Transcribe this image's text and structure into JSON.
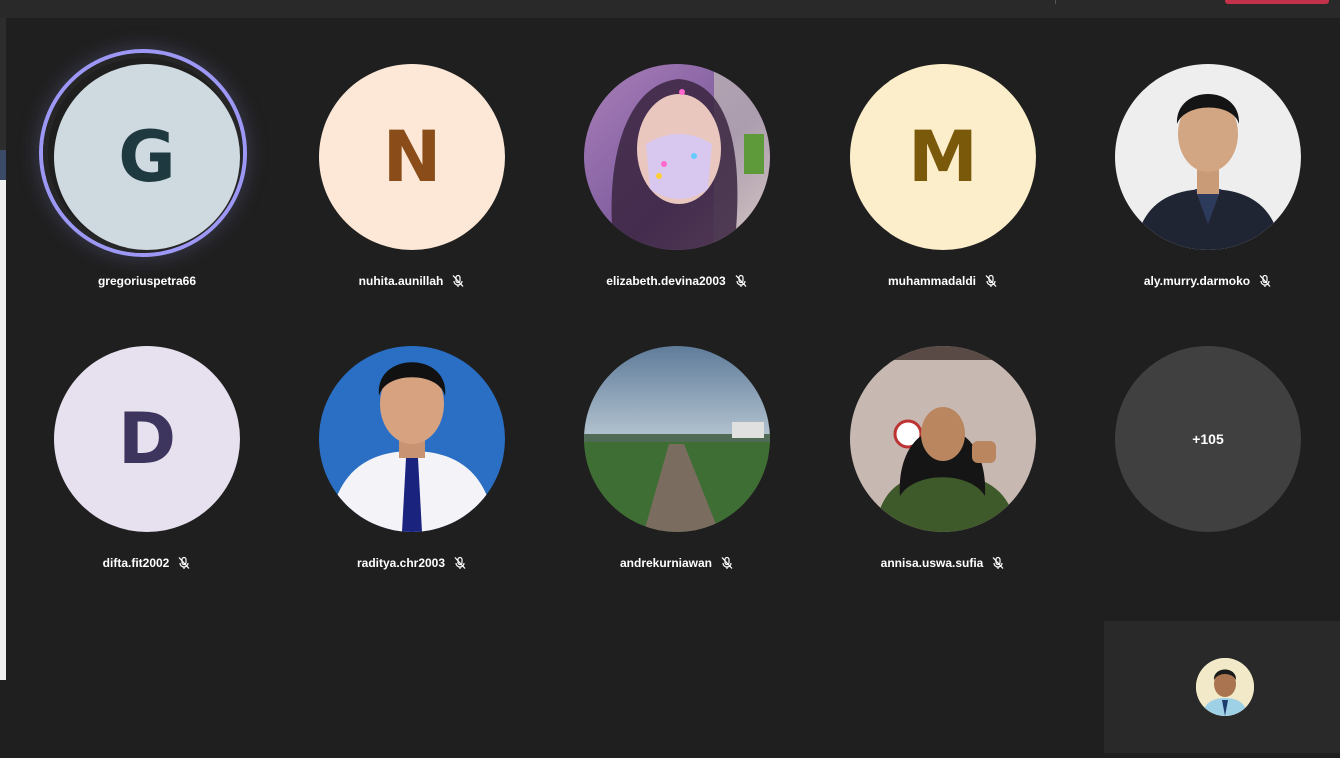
{
  "meeting": {
    "more_participants_label": "+105"
  },
  "participants": [
    {
      "name": "gregoriuspetra66",
      "initial": "G",
      "speaking": true,
      "muted": false,
      "bg": "#cfdae0",
      "fg": "#1e3a40"
    },
    {
      "name": "nuhita.aunillah",
      "initial": "N",
      "muted": true,
      "bg": "#fde8d7",
      "fg": "#8a4d1a"
    },
    {
      "name": "elizabeth.devina2003",
      "muted": true,
      "photo": "masked-person-photo"
    },
    {
      "name": "muhammadaldi",
      "initial": "M",
      "muted": true,
      "bg": "#fdeecb",
      "fg": "#7a5a0a"
    },
    {
      "name": "aly.murry.darmoko",
      "muted": true,
      "photo": "man-dark-shirt-photo"
    },
    {
      "name": "difta.fit2002",
      "initial": "D",
      "muted": true,
      "bg": "#e6e0ef",
      "fg": "#3d355e"
    },
    {
      "name": "raditya.chr2003",
      "muted": true,
      "photo": "man-blue-background-photo"
    },
    {
      "name": "andrekurniawan",
      "muted": true,
      "photo": "rice-field-path-photo"
    },
    {
      "name": "annisa.uswa.sufia",
      "muted": true,
      "photo": "woman-hijab-thumbs-up-photo"
    }
  ],
  "colors": {
    "stage_bg": "#1f1f1f",
    "speaking_ring": "#9d98f5",
    "more_tile_bg": "#404040",
    "leave_button": "#c4314b"
  }
}
